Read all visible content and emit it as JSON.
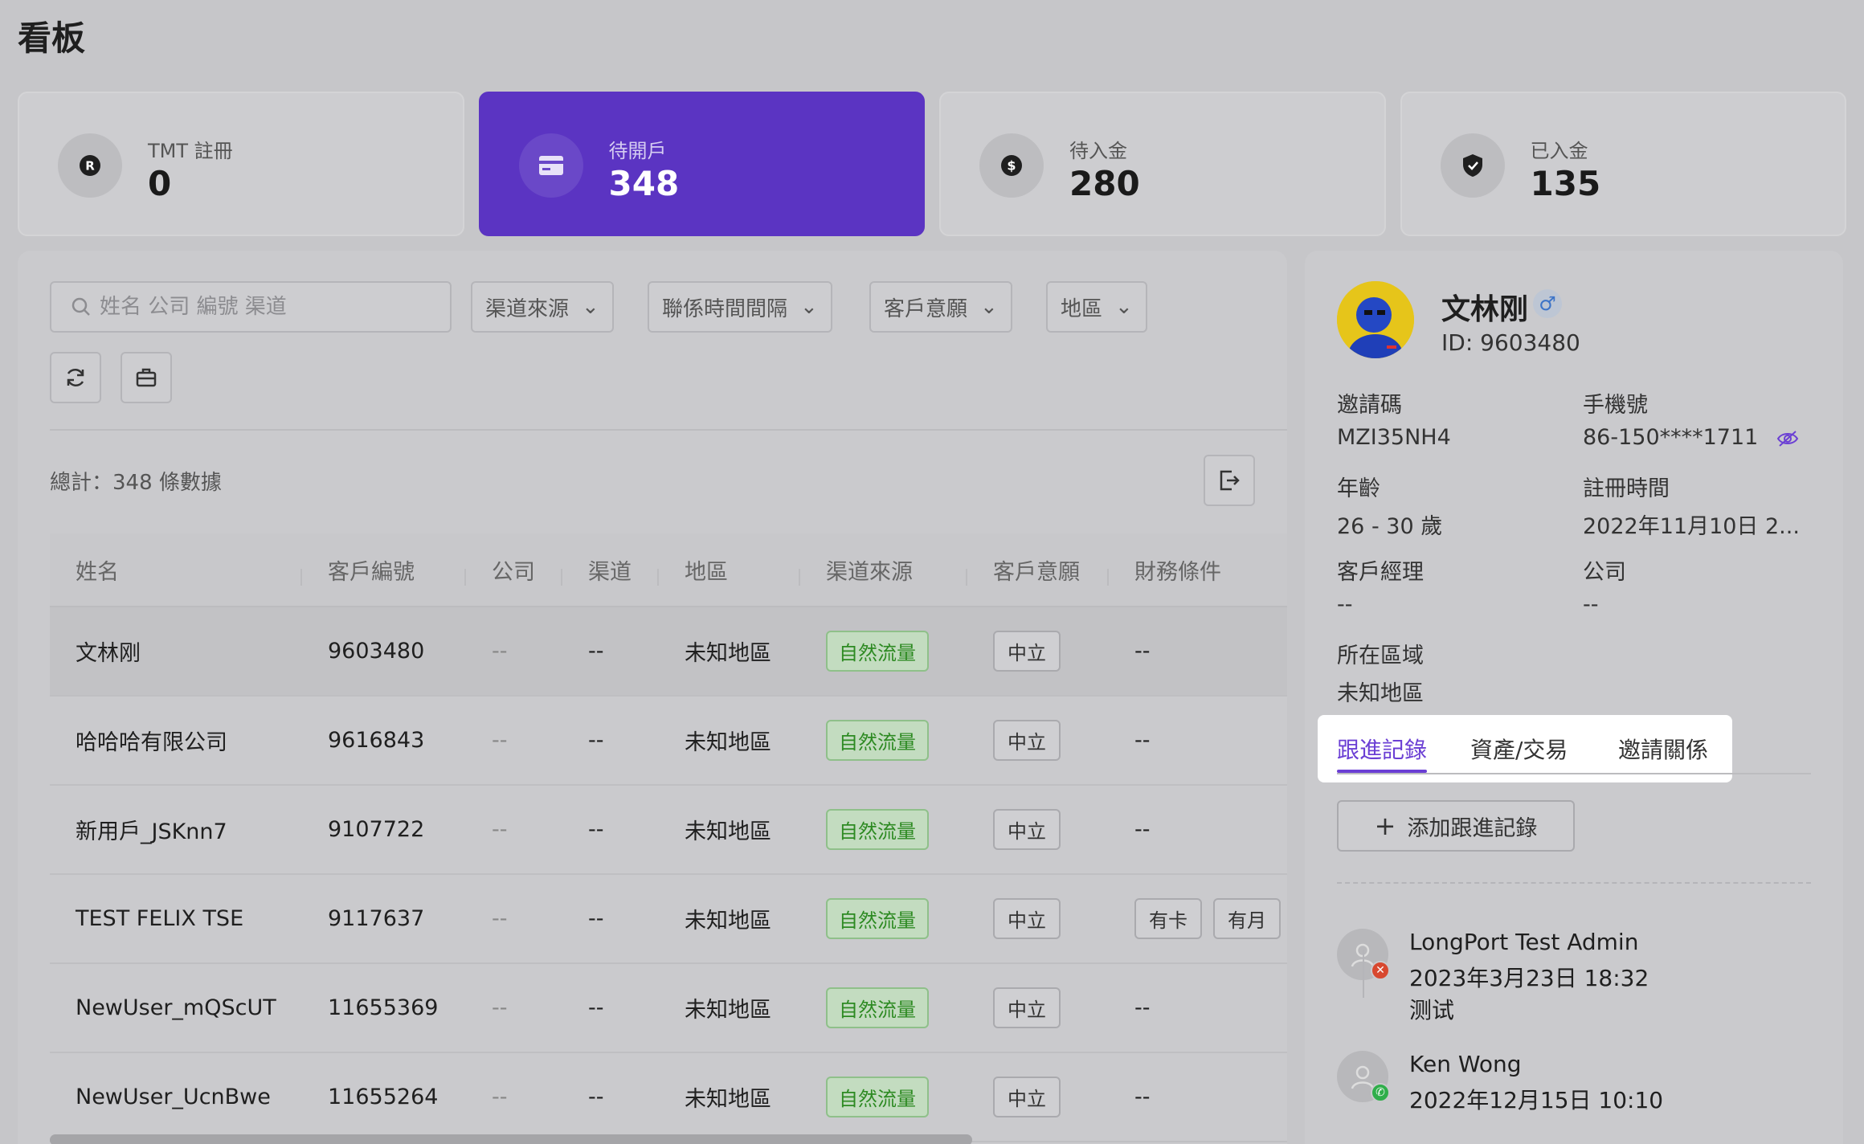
{
  "page": {
    "title": "看板"
  },
  "colors": {
    "accent": "#5b34c2",
    "tab_active": "#6b3fd4",
    "tag_green": "#2d8a22"
  },
  "stats": [
    {
      "icon": "registered-icon",
      "label": "TMT 註冊",
      "value": "0"
    },
    {
      "icon": "card-icon",
      "label": "待開戶",
      "value": "348"
    },
    {
      "icon": "dollar-icon",
      "label": "待入金",
      "value": "280"
    },
    {
      "icon": "shield-icon",
      "label": "已入金",
      "value": "135"
    }
  ],
  "filters": {
    "search_placeholder": "姓名 公司 編號 渠道",
    "channel_source": "渠道來源",
    "contact_interval": "聯係時間間隔",
    "customer_intent": "客戶意願",
    "region": "地區"
  },
  "total_label": "總計：348 條數據",
  "table": {
    "headers": [
      "姓名",
      "客戶編號",
      "公司",
      "渠道",
      "地區",
      "渠道來源",
      "客戶意願",
      "財務條件"
    ],
    "rows": [
      {
        "name": "文林刚",
        "code": "9603480",
        "company": "--",
        "channel": "--",
        "region": "未知地區",
        "source": "自然流量",
        "intent": "中立",
        "finance": "--"
      },
      {
        "name": "哈哈哈有限公司",
        "code": "9616843",
        "company": "--",
        "channel": "--",
        "region": "未知地區",
        "source": "自然流量",
        "intent": "中立",
        "finance": "--"
      },
      {
        "name": "新用戶_JSKnn7",
        "code": "9107722",
        "company": "--",
        "channel": "--",
        "region": "未知地區",
        "source": "自然流量",
        "intent": "中立",
        "finance": "--"
      },
      {
        "name": "TEST FELIX TSE",
        "code": "9117637",
        "company": "--",
        "channel": "--",
        "region": "未知地區",
        "source": "自然流量",
        "intent": "中立",
        "finance_tags": [
          "有卡",
          "有月"
        ]
      },
      {
        "name": "NewUser_mQScUT",
        "code": "11655369",
        "company": "--",
        "channel": "--",
        "region": "未知地區",
        "source": "自然流量",
        "intent": "中立",
        "finance": "--"
      },
      {
        "name": "NewUser_UcnBwe",
        "code": "11655264",
        "company": "--",
        "channel": "--",
        "region": "未知地區",
        "source": "自然流量",
        "intent": "中立",
        "finance": "--"
      }
    ]
  },
  "detail": {
    "name": "文林刚",
    "gender": "♂",
    "id": "ID: 9603480",
    "fields": {
      "invite_code_label": "邀請碼",
      "invite_code": "MZI35NH4",
      "phone_label": "手機號",
      "phone": "86-150****1711",
      "age_label": "年齡",
      "age": "26 - 30 歲",
      "reg_time_label": "註冊時間",
      "reg_time": "2022年11月10日 2...",
      "manager_label": "客戶經理",
      "manager": "--",
      "company_label": "公司",
      "company": "--",
      "area_label": "所在區域",
      "area": "未知地區"
    },
    "tabs": [
      "跟進記錄",
      "資產/交易",
      "邀請關係"
    ],
    "add_label": "添加跟進記錄",
    "records": [
      {
        "who": "LongPort Test Admin",
        "when": "2023年3月23日 18:32",
        "note": "测试"
      },
      {
        "who": "Ken Wong",
        "when": "2022年12月15日 10:10"
      }
    ]
  }
}
